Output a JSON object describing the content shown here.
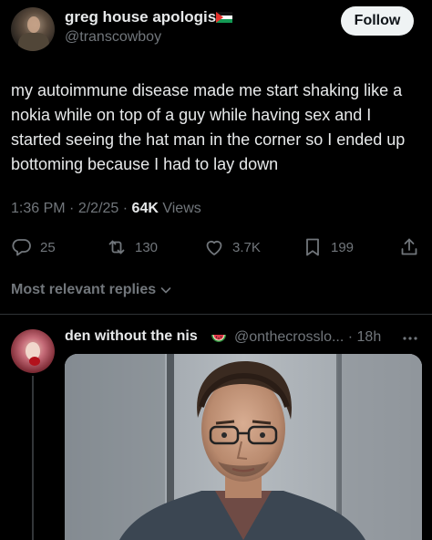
{
  "tweet": {
    "author": {
      "display_name": "greg house apologist",
      "handle": "@transcowboy",
      "avatar_icon": "avatar-photo",
      "flag_icon": "palestine-flag-emoji"
    },
    "follow_label": "Follow",
    "text": "my autoimmune disease made me start shaking like a nokia while on top of a guy while having sex and I started seeing the hat man in the corner so I ended up bottoming because I had to lay down",
    "time": "1:36 PM",
    "date": "2/2/25",
    "separator": "·",
    "views_count": "64K",
    "views_label": "Views",
    "stats": {
      "replies": "25",
      "retweets": "130",
      "likes": "3.7K",
      "bookmarks": "199"
    },
    "icons": {
      "reply": "reply-icon",
      "retweet": "retweet-icon",
      "like": "heart-icon",
      "bookmark": "bookmark-icon",
      "share": "share-icon"
    }
  },
  "replies_filter": {
    "label": "Most relevant replies",
    "icon": "chevron-down-icon"
  },
  "reply": {
    "display_name": "den without the nis",
    "emoji_icon": "watermelon-emoji",
    "handle_time": "@onthecrosslo... · 18h",
    "more_icon": "more-icon",
    "image_icon": "attached-photo"
  },
  "colors": {
    "background": "#000000",
    "text_primary": "#e7e9ea",
    "text_secondary": "#71767b",
    "follow_button_bg": "#eff3f4",
    "divider": "#2f3336"
  }
}
